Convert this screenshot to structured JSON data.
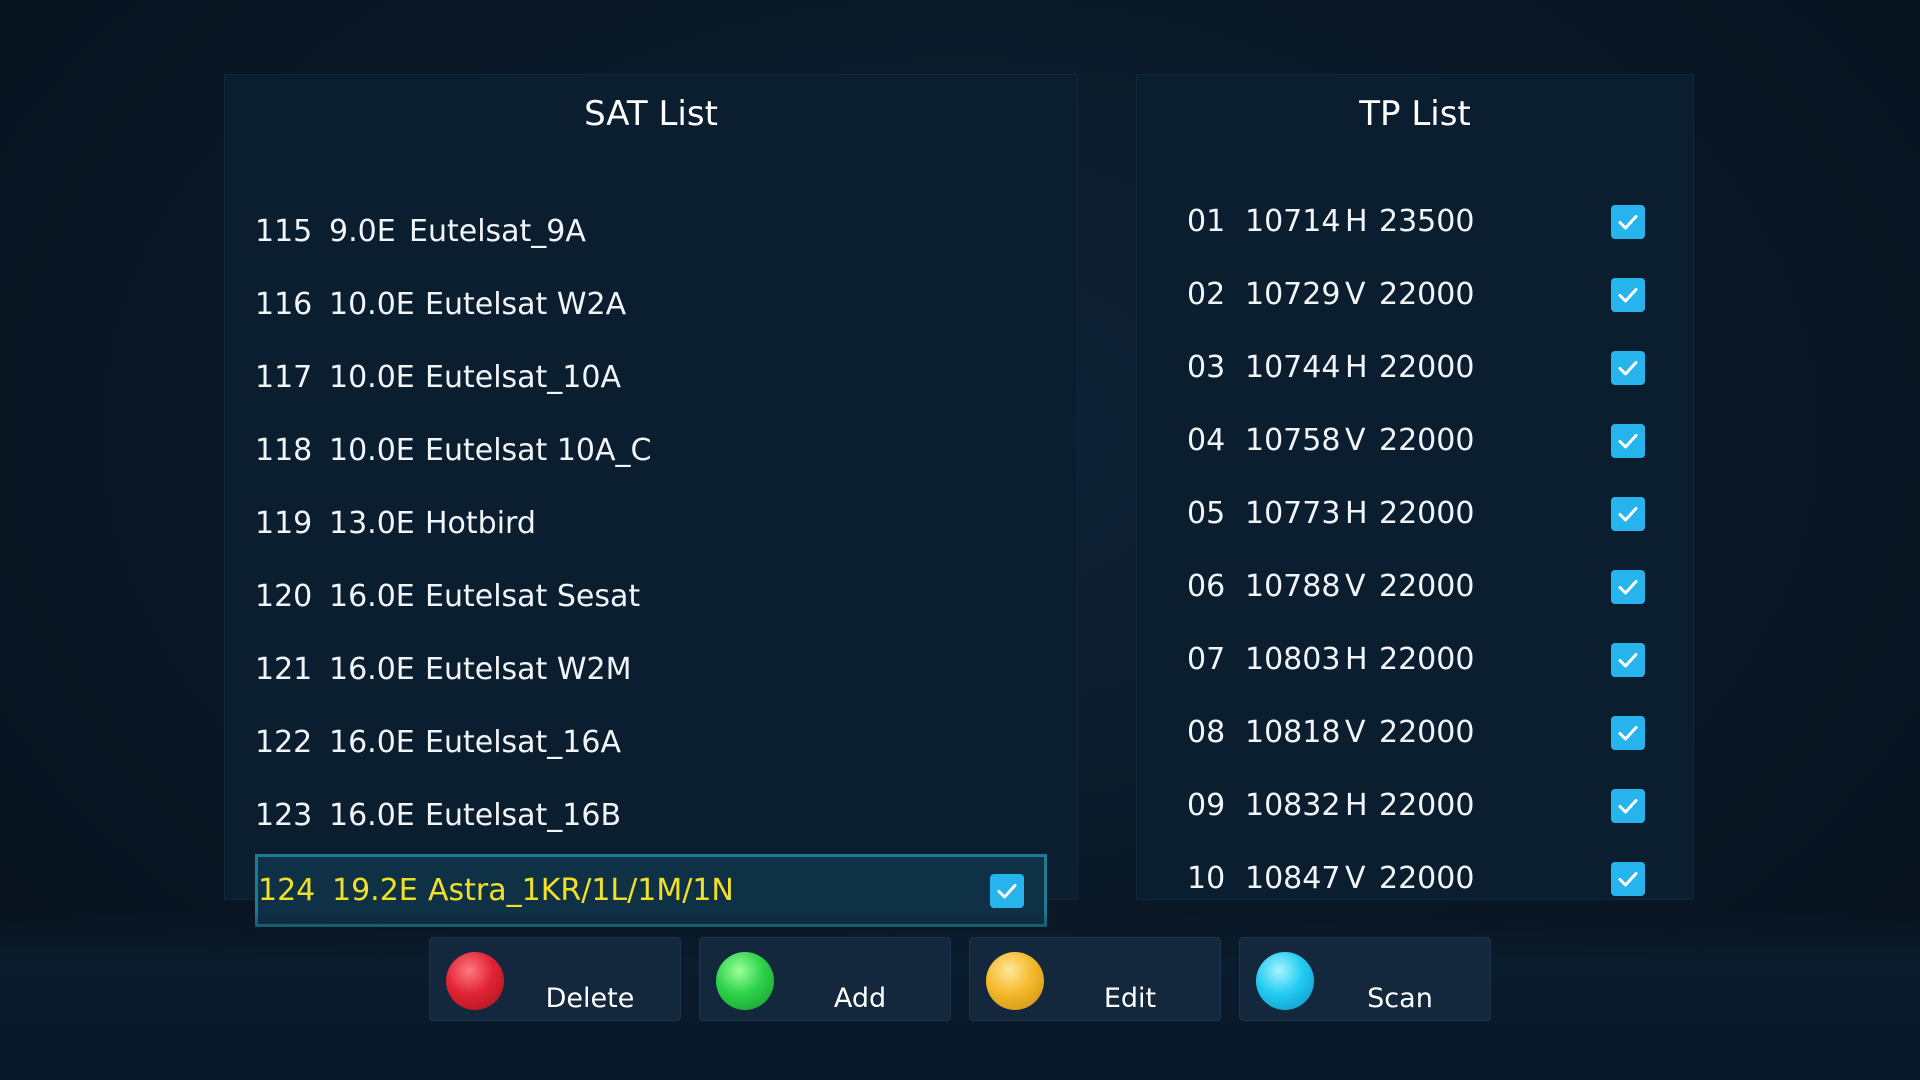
{
  "sat_list": {
    "title": "SAT List",
    "items": [
      {
        "num": "115",
        "pos": "9.0E",
        "name": "Eutelsat_9A"
      },
      {
        "num": "116",
        "pos": "10.0E",
        "name": "Eutelsat W2A"
      },
      {
        "num": "117",
        "pos": "10.0E",
        "name": "Eutelsat_10A"
      },
      {
        "num": "118",
        "pos": "10.0E",
        "name": "Eutelsat 10A_C"
      },
      {
        "num": "119",
        "pos": "13.0E",
        "name": "Hotbird"
      },
      {
        "num": "120",
        "pos": "16.0E",
        "name": "Eutelsat Sesat"
      },
      {
        "num": "121",
        "pos": "16.0E",
        "name": "Eutelsat W2M"
      },
      {
        "num": "122",
        "pos": "16.0E",
        "name": "Eutelsat_16A"
      },
      {
        "num": "123",
        "pos": "16.0E",
        "name": "Eutelsat_16B"
      },
      {
        "num": "124",
        "pos": "19.2E",
        "name": "Astra_1KR/1L/1M/1N",
        "selected": true,
        "checked": true
      }
    ]
  },
  "tp_list": {
    "title": "TP List",
    "items": [
      {
        "num": "01",
        "freq": "10714",
        "pol": "H",
        "rate": "23500",
        "checked": true
      },
      {
        "num": "02",
        "freq": "10729",
        "pol": "V",
        "rate": "22000",
        "checked": true
      },
      {
        "num": "03",
        "freq": "10744",
        "pol": "H",
        "rate": "22000",
        "checked": true
      },
      {
        "num": "04",
        "freq": "10758",
        "pol": "V",
        "rate": "22000",
        "checked": true
      },
      {
        "num": "05",
        "freq": "10773",
        "pol": "H",
        "rate": "22000",
        "checked": true
      },
      {
        "num": "06",
        "freq": "10788",
        "pol": "V",
        "rate": "22000",
        "checked": true
      },
      {
        "num": "07",
        "freq": "10803",
        "pol": "H",
        "rate": "22000",
        "checked": true
      },
      {
        "num": "08",
        "freq": "10818",
        "pol": "V",
        "rate": "22000",
        "checked": true
      },
      {
        "num": "09",
        "freq": "10832",
        "pol": "H",
        "rate": "22000",
        "checked": true
      },
      {
        "num": "10",
        "freq": "10847",
        "pol": "V",
        "rate": "22000",
        "checked": true
      }
    ]
  },
  "footer": {
    "buttons": [
      {
        "label": "Delete",
        "color": "#d8202e",
        "icon": "red-circle-icon"
      },
      {
        "label": "Add",
        "color": "#2ec84a",
        "icon": "green-circle-icon"
      },
      {
        "label": "Edit",
        "color": "#f0b428",
        "icon": "yellow-circle-icon"
      },
      {
        "label": "Scan",
        "color": "#1ec8f0",
        "icon": "blue-circle-icon"
      }
    ]
  },
  "colors": {
    "selected_text": "#f0e028",
    "check_bg": "#27b4ec",
    "panel_bg": "#0b1e30"
  }
}
